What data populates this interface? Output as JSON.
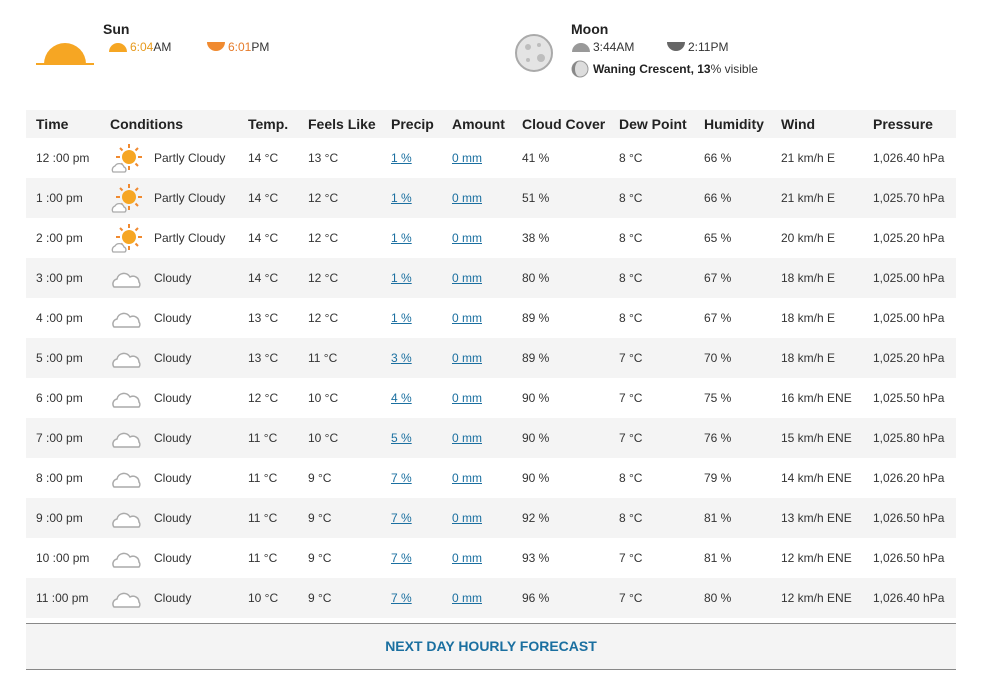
{
  "sun": {
    "title": "Sun",
    "rise_time": "6:04",
    "rise_ampm": "AM",
    "set_time": "6:01",
    "set_ampm": "PM"
  },
  "moon": {
    "title": "Moon",
    "rise": "3:44AM",
    "set": "2:11PM",
    "phase": "Waning Crescent, 13",
    "visible": " % visible"
  },
  "colors": {
    "accent": "#1a6fa0",
    "sun_orange": "#f6a623",
    "row_alt_bg": "#f4f4f4"
  },
  "table": {
    "headers": [
      "Time",
      "Conditions",
      "Temp.",
      "Feels Like",
      "Precip",
      "Amount",
      "Cloud Cover",
      "Dew Point",
      "Humidity",
      "Wind",
      "Pressure"
    ],
    "rows": [
      {
        "time": "12 :00 pm",
        "icon": "partly-cloudy-icon",
        "cond": "Partly Cloudy",
        "temp": "14 °C",
        "feels": "13 °C",
        "precip": "1 %",
        "amount": "0 mm",
        "cloud": "41 %",
        "dew": "8 °C",
        "hum": "66 %",
        "wind": "21 km/h E",
        "press": "1,026.40 hPa"
      },
      {
        "time": "1 :00 pm",
        "icon": "partly-cloudy-icon",
        "cond": "Partly Cloudy",
        "temp": "14 °C",
        "feels": "12 °C",
        "precip": "1 %",
        "amount": "0 mm",
        "cloud": "51 %",
        "dew": "8 °C",
        "hum": "66 %",
        "wind": "21 km/h E",
        "press": "1,025.70 hPa"
      },
      {
        "time": "2 :00 pm",
        "icon": "partly-cloudy-icon",
        "cond": "Partly Cloudy",
        "temp": "14 °C",
        "feels": "12 °C",
        "precip": "1 %",
        "amount": "0 mm",
        "cloud": "38 %",
        "dew": "8 °C",
        "hum": "65 %",
        "wind": "20 km/h E",
        "press": "1,025.20 hPa"
      },
      {
        "time": "3 :00 pm",
        "icon": "cloudy-icon",
        "cond": "Cloudy",
        "temp": "14 °C",
        "feels": "12 °C",
        "precip": "1 %",
        "amount": "0 mm",
        "cloud": "80 %",
        "dew": "8 °C",
        "hum": "67 %",
        "wind": "18 km/h E",
        "press": "1,025.00 hPa"
      },
      {
        "time": "4 :00 pm",
        "icon": "cloudy-icon",
        "cond": "Cloudy",
        "temp": "13 °C",
        "feels": "12 °C",
        "precip": "1 %",
        "amount": "0 mm",
        "cloud": "89 %",
        "dew": "8 °C",
        "hum": "67 %",
        "wind": "18 km/h E",
        "press": "1,025.00 hPa"
      },
      {
        "time": "5 :00 pm",
        "icon": "cloudy-icon",
        "cond": "Cloudy",
        "temp": "13 °C",
        "feels": "11 °C",
        "precip": "3 %",
        "amount": "0 mm",
        "cloud": "89 %",
        "dew": "7 °C",
        "hum": "70 %",
        "wind": "18 km/h E",
        "press": "1,025.20 hPa"
      },
      {
        "time": "6 :00 pm",
        "icon": "cloudy-icon",
        "cond": "Cloudy",
        "temp": "12 °C",
        "feels": "10 °C",
        "precip": "4 %",
        "amount": "0 mm",
        "cloud": "90 %",
        "dew": "7 °C",
        "hum": "75 %",
        "wind": "16 km/h ENE",
        "press": "1,025.50 hPa"
      },
      {
        "time": "7 :00 pm",
        "icon": "cloudy-icon",
        "cond": "Cloudy",
        "temp": "11 °C",
        "feels": "10 °C",
        "precip": "5 %",
        "amount": "0 mm",
        "cloud": "90 %",
        "dew": "7 °C",
        "hum": "76 %",
        "wind": "15 km/h ENE",
        "press": "1,025.80 hPa"
      },
      {
        "time": "8 :00 pm",
        "icon": "cloudy-icon",
        "cond": "Cloudy",
        "temp": "11 °C",
        "feels": "9 °C",
        "precip": "7 %",
        "amount": "0 mm",
        "cloud": "90 %",
        "dew": "8 °C",
        "hum": "79 %",
        "wind": "14 km/h ENE",
        "press": "1,026.20 hPa"
      },
      {
        "time": "9 :00 pm",
        "icon": "cloudy-icon",
        "cond": "Cloudy",
        "temp": "11 °C",
        "feels": "9 °C",
        "precip": "7 %",
        "amount": "0 mm",
        "cloud": "92 %",
        "dew": "8 °C",
        "hum": "81 %",
        "wind": "13 km/h ENE",
        "press": "1,026.50 hPa"
      },
      {
        "time": "10 :00 pm",
        "icon": "cloudy-icon",
        "cond": "Cloudy",
        "temp": "11 °C",
        "feels": "9 °C",
        "precip": "7 %",
        "amount": "0 mm",
        "cloud": "93 %",
        "dew": "7 °C",
        "hum": "81 %",
        "wind": "12 km/h ENE",
        "press": "1,026.50 hPa"
      },
      {
        "time": "11 :00 pm",
        "icon": "cloudy-icon",
        "cond": "Cloudy",
        "temp": "10 °C",
        "feels": "9 °C",
        "precip": "7 %",
        "amount": "0 mm",
        "cloud": "96 %",
        "dew": "7 °C",
        "hum": "80 %",
        "wind": "12 km/h ENE",
        "press": "1,026.40 hPa"
      }
    ]
  },
  "footer": {
    "label": "NEXT DAY HOURLY FORECAST"
  }
}
